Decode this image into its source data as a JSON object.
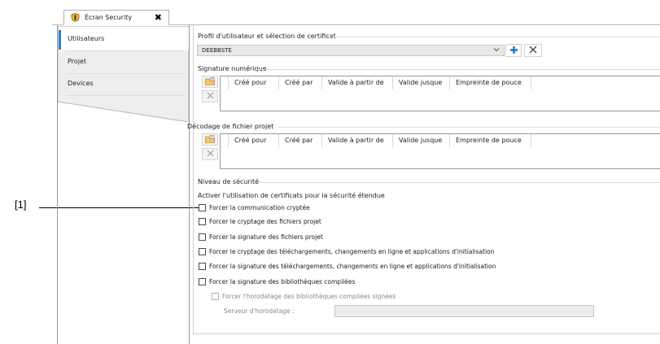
{
  "callout": {
    "label": "[1]"
  },
  "tab": {
    "title": "Écran Security",
    "close": "✖"
  },
  "sidebar": {
    "items": [
      {
        "label": "Utilisateurs",
        "selected": true
      },
      {
        "label": "Projet",
        "selected": false
      },
      {
        "label": "Devices",
        "selected": false
      }
    ]
  },
  "profile": {
    "title": "Profil d'utilisateur et sélection de certificat",
    "selected_user": "DEEBBSTE"
  },
  "signature": {
    "title": "Signature numérique",
    "columns": [
      "Créé pour",
      "Créé par",
      "Valide à partir de",
      "Valide jusque",
      "Empreinte de pouce"
    ]
  },
  "decoding": {
    "title": "Décodage de fichier projet",
    "columns": [
      "Créé pour",
      "Créé par",
      "Valide à partir de",
      "Valide jusque",
      "Empreinte de pouce"
    ]
  },
  "security": {
    "title": "Niveau de sécurité",
    "intro": "Activer l'utilisation de certificats pour la sécurité étendue",
    "options": [
      "Forcer la communication cryptée",
      "Forcer le cryptage des fichiers projet",
      "Forcer la signature des fichiers projet",
      "Forcer le cryptage des téléchargements, changements en ligne et applications d'initialisation",
      "Forcer la signature des téléchargements, changements en ligne et applications d'initialisation",
      "Forcer la signature des bibliothèques compilées"
    ],
    "timestamp_option": "Forcer l'horodatage des bibliothèques compilées signées",
    "timestamp_server_label": "Serveur d'horodatage :",
    "timestamp_server_value": ""
  },
  "colors": {
    "accent": "#2f7fd1",
    "add_icon": "#1e73c8"
  },
  "icons": {
    "tab": "shield-icon",
    "add": "plus-icon",
    "delete": "close-x-icon",
    "import": "folder-certificate-icon",
    "dropdown": "chevron-down-icon"
  }
}
